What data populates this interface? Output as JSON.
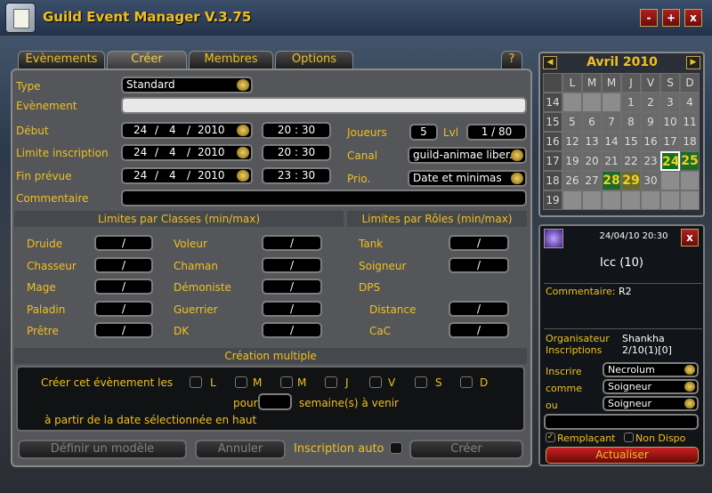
{
  "window": {
    "title": "Guild Event Manager V.3.75",
    "buttons": [
      "-",
      "+",
      "x"
    ]
  },
  "tabs": [
    "Evènements",
    "Créer",
    "Membres",
    "Options",
    "?"
  ],
  "form": {
    "type_label": "Type",
    "type_value": "Standard",
    "event_label": "Evènement",
    "start_label": "Début",
    "start_day": "24",
    "start_month": "4",
    "start_year": "2010",
    "start_time": "20 : 30",
    "limit_label": "Limite inscription",
    "limit_day": "24",
    "limit_month": "4",
    "limit_year": "2010",
    "limit_time": "20 : 30",
    "end_label": "Fin prévue",
    "end_day": "24",
    "end_month": "4",
    "end_year": "2010",
    "end_time": "23 : 30",
    "players_label": "Joueurs",
    "players_value": "5",
    "lvl_label": "Lvl",
    "lvl_value": "1 / 80",
    "channel_label": "Canal",
    "channel_value": "guild-animae liber...",
    "prio_label": "Prio.",
    "prio_value": "Date et minimas",
    "comment_label": "Commentaire"
  },
  "limits": {
    "classes_header": "Limites par Classes (min/max)",
    "roles_header": "Limites par Rôles (min/max)",
    "classes_left": [
      "Druide",
      "Chasseur",
      "Mage",
      "Paladin",
      "Prêtre"
    ],
    "classes_right": [
      "Voleur",
      "Chaman",
      "Démoniste",
      "Guerrier",
      "DK"
    ],
    "roles": [
      "Tank",
      "Soigneur",
      "DPS"
    ],
    "dps_sub": [
      "Distance",
      "CaC"
    ],
    "slash": "/"
  },
  "multi": {
    "header": "Création multiple",
    "create_label": "Créer cet évènement les",
    "days": [
      "L",
      "M",
      "M",
      "J",
      "V",
      "S",
      "D"
    ],
    "for_label": "pour",
    "weeks_label": "semaine(s) à venir",
    "from_label": "à partir de la date sélectionnée en haut"
  },
  "actions": {
    "template": "Définir un modèle",
    "cancel": "Annuler",
    "auto_label": "Inscription auto",
    "create": "Créer"
  },
  "calendar": {
    "month": "Avril 2010",
    "weekdays": [
      "L",
      "M",
      "M",
      "J",
      "V",
      "S",
      "D"
    ],
    "weeks": [
      "14",
      "15",
      "16",
      "17",
      "18",
      "19"
    ],
    "rows": [
      [
        "",
        "",
        "",
        "1",
        "2",
        "3",
        "4"
      ],
      [
        "5",
        "6",
        "7",
        "8",
        "9",
        "10",
        "11"
      ],
      [
        "12",
        "13",
        "14",
        "15",
        "16",
        "17",
        "18"
      ],
      [
        "19",
        "20",
        "21",
        "22",
        "23",
        "24",
        "25"
      ],
      [
        "26",
        "27",
        "28",
        "29",
        "30",
        "",
        ""
      ],
      [
        "",
        "",
        "",
        "",
        "",
        "",
        ""
      ]
    ]
  },
  "detail": {
    "datetime": "24/04/10 20:30",
    "event_name": "Icc (10)",
    "comment_label": "Commentaire:",
    "comment_value": "R2",
    "organizer_label": "Organisateur",
    "organizer_value": "Shankha",
    "signups_label": "Inscriptions",
    "signups_value": "2/10(1)[0]",
    "register_label": "Inscrire",
    "register_value": "Necrolum",
    "as_label": "comme",
    "as_value": "Soigneur",
    "or_label": "ou",
    "or_value": "Soigneur",
    "replacing_label": "Remplaçant",
    "unavailable_label": "Non Dispo",
    "update_button": "Actualiser"
  }
}
